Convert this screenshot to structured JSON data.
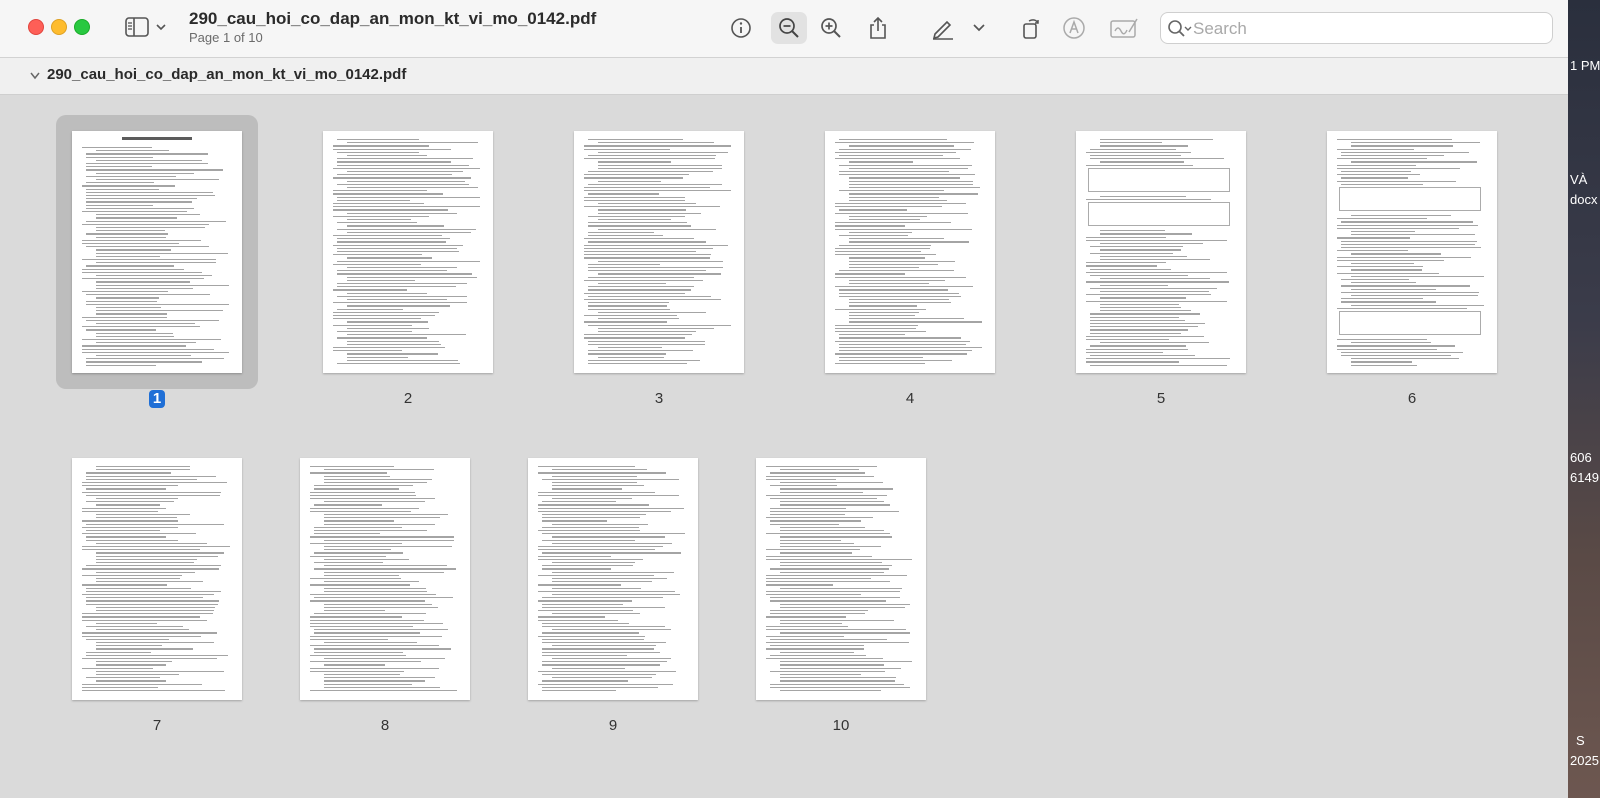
{
  "window": {
    "title": "290_cau_hoi_co_dap_an_mon_kt_vi_mo_0142.pdf",
    "page_info": "Page 1 of 10",
    "file_bar_name": "290_cau_hoi_co_dap_an_mon_kt_vi_mo_0142.pdf"
  },
  "toolbar": {
    "icons": [
      "info-icon",
      "zoom-out-icon",
      "zoom-in-icon",
      "share-icon",
      "markup-pen-icon",
      "chevron-down-icon",
      "rotate-icon",
      "markup-icon",
      "signature-icon"
    ],
    "active": "zoom-out-icon"
  },
  "search": {
    "placeholder": "Search",
    "value": ""
  },
  "pages": [
    {
      "label": "1",
      "selected": true
    },
    {
      "label": "2",
      "selected": false
    },
    {
      "label": "3",
      "selected": false
    },
    {
      "label": "4",
      "selected": false
    },
    {
      "label": "5",
      "selected": false
    },
    {
      "label": "6",
      "selected": false
    },
    {
      "label": "7",
      "selected": false
    },
    {
      "label": "8",
      "selected": false
    },
    {
      "label": "9",
      "selected": false
    },
    {
      "label": "10",
      "selected": false
    }
  ],
  "desktop_fragments": [
    "1 PM",
    "VÀ",
    "docx",
    "606",
    "6149",
    "S",
    "2025"
  ],
  "colors": {
    "selection": "#1f6fd6",
    "close": "#fe5f57",
    "minimize": "#febc2e",
    "zoom": "#28c840"
  }
}
